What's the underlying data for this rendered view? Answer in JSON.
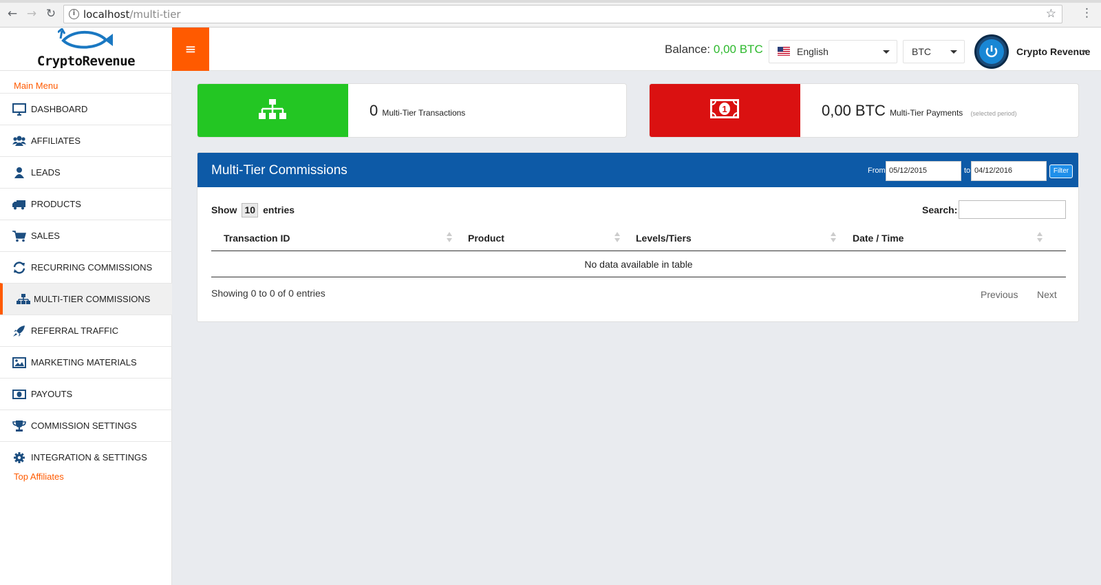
{
  "browser": {
    "url_host": "localhost",
    "url_path": "/multi-tier"
  },
  "brand": {
    "name": "CryptoRevenue",
    "accent": "#ff5a00",
    "header_blue": "#0d5aa7"
  },
  "header": {
    "balance_label": "Balance:",
    "balance_value": "0,00 BTC",
    "language": "English",
    "currency": "BTC",
    "user_name": "Crypto Revenue"
  },
  "sidebar": {
    "main_menu": "Main Menu",
    "top_affiliates": "Top Affiliates",
    "items": [
      {
        "label": "DASHBOARD",
        "icon": "monitor-icon"
      },
      {
        "label": "AFFILIATES",
        "icon": "users-icon"
      },
      {
        "label": "LEADS",
        "icon": "user-icon"
      },
      {
        "label": "PRODUCTS",
        "icon": "truck-icon"
      },
      {
        "label": "SALES",
        "icon": "cart-icon"
      },
      {
        "label": "RECURRING COMMISSIONS",
        "icon": "refresh-icon"
      },
      {
        "label": "MULTI-TIER COMMISSIONS",
        "icon": "sitemap-icon",
        "active": true
      },
      {
        "label": "REFERRAL TRAFFIC",
        "icon": "rocket-icon"
      },
      {
        "label": "MARKETING MATERIALS",
        "icon": "image-icon"
      },
      {
        "label": "PAYOUTS",
        "icon": "money-icon"
      },
      {
        "label": "COMMISSION SETTINGS",
        "icon": "trophy-icon"
      },
      {
        "label": "INTEGRATION & SETTINGS",
        "icon": "gear-icon"
      }
    ]
  },
  "stats": {
    "transactions": {
      "value": "0",
      "label": "Multi-Tier Transactions",
      "color": "#23c623",
      "icon": "sitemap-icon"
    },
    "payments": {
      "value": "0,00 BTC",
      "label": "Multi-Tier Payments",
      "note": "(selected period)",
      "color": "#da1111",
      "icon": "money-icon"
    }
  },
  "panel": {
    "title": "Multi-Tier Commissions",
    "from_label": "From",
    "to_label": "to",
    "date_from": "05/12/2015",
    "date_to": "04/12/2016",
    "filter_label": "Filter",
    "show_label": "Show",
    "show_value": "10",
    "entries_label": "entries",
    "search_label": "Search:",
    "columns": [
      "Transaction ID",
      "Product",
      "Levels/Tiers",
      "Date / Time"
    ],
    "empty_message": "No data available in table",
    "info": "Showing 0 to 0 of 0 entries",
    "prev_label": "Previous",
    "next_label": "Next"
  }
}
